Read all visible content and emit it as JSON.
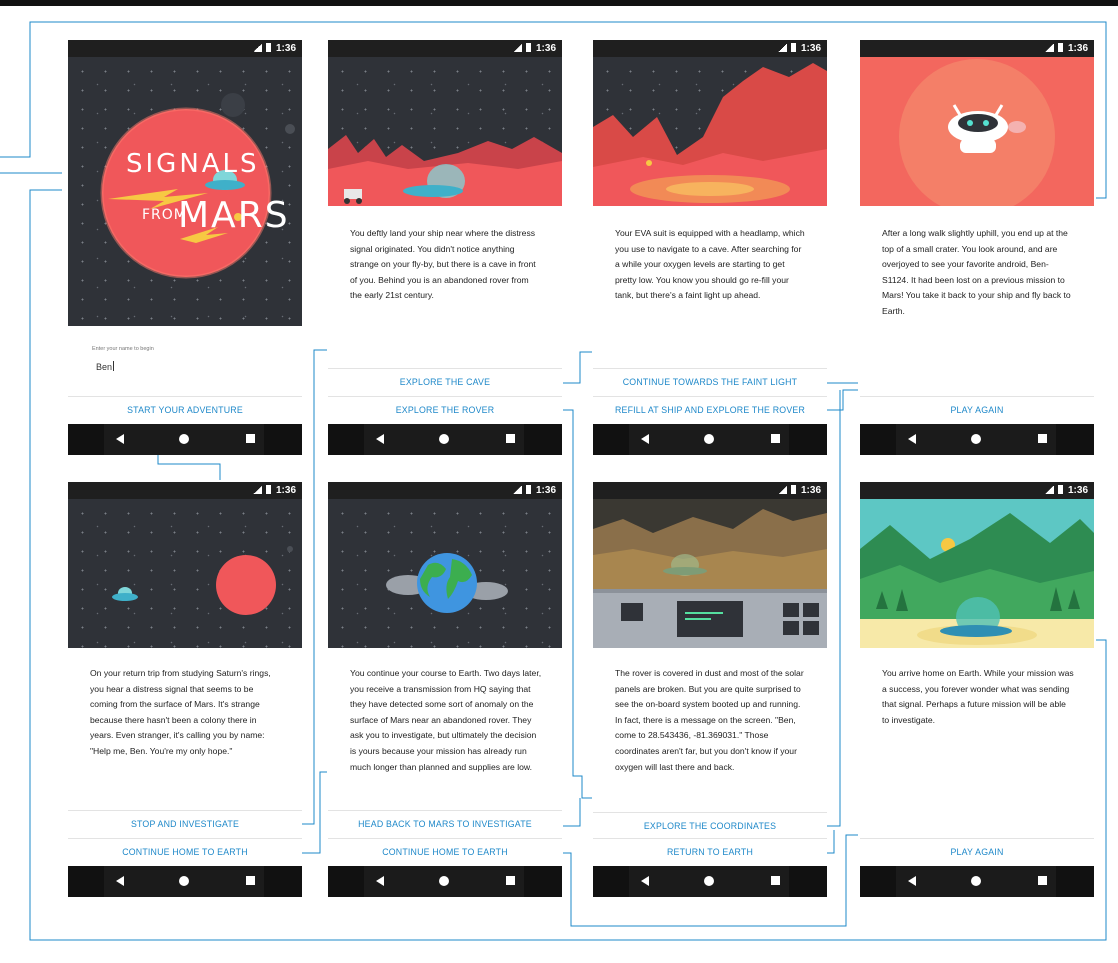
{
  "status_bar": {
    "network": "4G",
    "time": "1:36"
  },
  "intro": {
    "title_line1": "SIGNALS",
    "title_line2": "FROM",
    "title_line3": "MARS",
    "name_label": "Enter your name to begin",
    "name_value": "Ben",
    "start_button": "START YOUR ADVENTURE"
  },
  "screens": [
    {
      "text": "You deftly land your ship near where the distress signal originated.  You didn't notice anything strange on your fly-by, but there is a cave in front of you. Behind you is an abandoned rover from the early 21st century.",
      "buttons": [
        "EXPLORE THE CAVE",
        "EXPLORE THE ROVER"
      ]
    },
    {
      "text": "Your EVA suit is equipped with a headlamp, which you use to navigate to a cave. After searching for a while your oxygen levels are starting to get pretty low. You know you should go re-fill your tank, but there's a faint light up ahead.",
      "buttons": [
        "CONTINUE TOWARDS THE FAINT LIGHT",
        "REFILL AT SHIP AND EXPLORE THE ROVER"
      ]
    },
    {
      "text": "After a long walk slightly uphill, you end up at the top of a small crater.  You look around, and are overjoyed to see your favorite android, Ben-S1124. It had been lost on a previous mission to Mars! You take it back to your ship and fly back to Earth.",
      "buttons": [
        "PLAY AGAIN"
      ]
    },
    {
      "text": "On your return trip from studying Saturn's rings, you hear a distress signal that seems to be coming from the surface of Mars.  It's strange because there hasn't been a colony there in years.  Even stranger, it's calling you by name: \"Help me, Ben. You're my only hope.\"",
      "buttons": [
        "STOP AND INVESTIGATE",
        "CONTINUE HOME TO EARTH"
      ]
    },
    {
      "text": "You continue your course to Earth. Two days later, you receive a transmission from HQ saying that they have detected some sort of anomaly on the surface of Mars near an abandoned rover. They ask you to investigate, but ultimately the decision is yours because your mission has already run much longer than planned and supplies are low.",
      "buttons": [
        "HEAD BACK TO MARS TO INVESTIGATE",
        "CONTINUE HOME TO EARTH"
      ]
    },
    {
      "text": "The rover is covered in dust and most of the solar panels are broken.  But you are quite surprised to see the on-board system booted up and running.  In fact, there is a message on the screen. \"Ben, come to 28.543436, -81.369031.\" Those coordinates aren't far, but you don't know if your oxygen will last there and back.",
      "buttons": [
        "EXPLORE THE COORDINATES",
        "RETURN TO EARTH"
      ]
    },
    {
      "text": "You arrive home on Earth. While your mission was a success, you forever wonder what was sending that signal. Perhaps a future mission will be able to investigate.",
      "buttons": [
        "PLAY AGAIN"
      ]
    }
  ],
  "colors": {
    "accent": "#1e88c9",
    "space": "#2f3238",
    "mars": "#f0575a",
    "desert": "#e04f48"
  }
}
